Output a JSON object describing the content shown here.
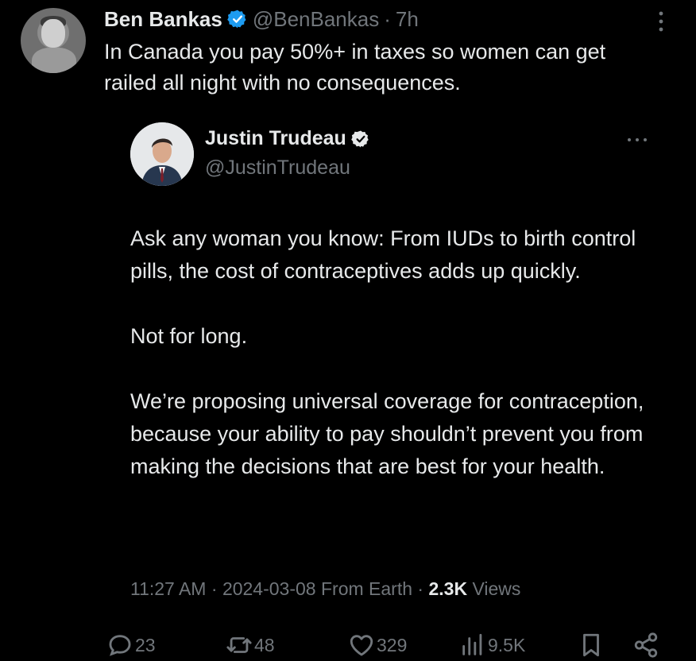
{
  "tweet": {
    "display_name": "Ben Bankas",
    "handle": "@BenBankas",
    "sep": "·",
    "time": "7h",
    "text": "In Canada you pay 50%+ in taxes so women can get\nrailed all night with no consequences."
  },
  "quoted": {
    "display_name": "Justin Trudeau",
    "handle": "@JustinTrudeau",
    "paragraphs": [
      "Ask any woman you know: From IUDs to birth control pills, the cost of contraceptives adds up quickly.",
      "Not for long.",
      "We’re proposing universal coverage for contraception, because your ability to pay shouldn’t prevent you from making the decisions that are best for your health."
    ],
    "meta": {
      "time": "11:27 AM",
      "date": "2024-03-08",
      "source": "From Earth",
      "views_count": "2.3K",
      "views_label": "Views"
    }
  },
  "actions": {
    "replies": "23",
    "reposts": "48",
    "likes": "329",
    "views": "9.5K"
  },
  "colors": {
    "background": "#000000",
    "text": "#e7e9ea",
    "secondary": "#71767b",
    "verified_badge": "#1d9bf0"
  },
  "icons": [
    "more-vertical-icon",
    "verified-badge-icon",
    "more-horizontal-icon",
    "reply-icon",
    "repost-icon",
    "like-icon",
    "views-icon",
    "bookmark-icon",
    "share-icon"
  ]
}
